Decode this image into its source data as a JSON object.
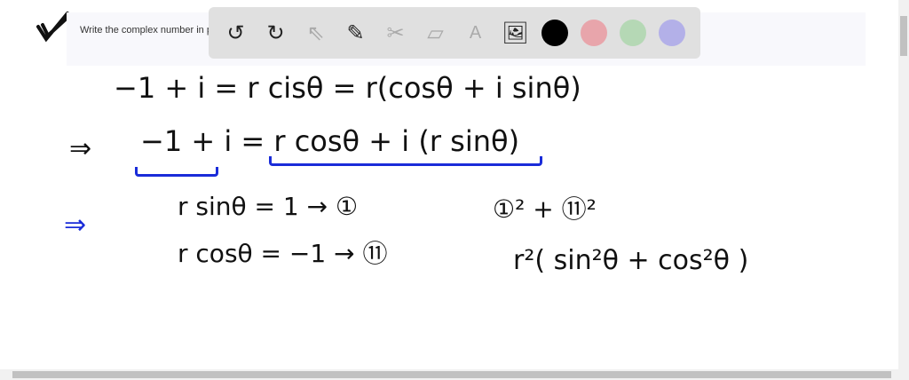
{
  "question": {
    "text": "Write the complex number in po"
  },
  "toolbar": {
    "undo": "↺",
    "redo": "↻",
    "select": "⇖",
    "pen": "✎",
    "tools": "✂",
    "eraser": "▱",
    "text": "A",
    "image": "🖼"
  },
  "colors": {
    "black": "#000000",
    "red": "#e8a5ab",
    "green": "#b5d8b5",
    "purple": "#b3b0e8"
  },
  "work": {
    "line1": "−1 + i = r cisθ = r(cosθ + i sinθ)",
    "line2_implies": "⇒",
    "line2": "−1 + i = r cosθ + i (r sinθ)",
    "implies_blue": "⇒",
    "eq1": "r sinθ = 1 → ①",
    "eq2": "r cosθ = −1 → ⑪",
    "sum": "①² + ⑪²",
    "result": "r²( sin²θ + cos²θ )"
  }
}
